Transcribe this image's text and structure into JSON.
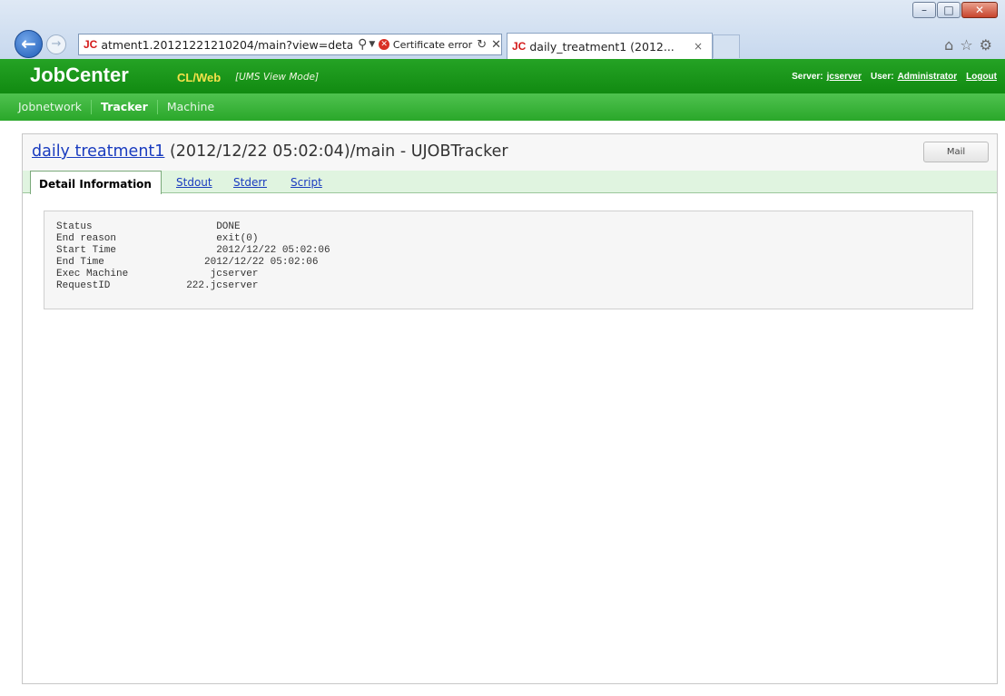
{
  "browser": {
    "window_controls": [
      "–",
      "□",
      "✕"
    ],
    "address": {
      "favicon_text": "JC",
      "url": "atment1.20121221210204/main?view=detail",
      "certificate_text": "Certificate error"
    },
    "tab": {
      "favicon_text": "JC",
      "title": "daily_treatment1 (2012...",
      "close": "×"
    },
    "icons": [
      "home-icon",
      "favorites-star-icon",
      "gear-icon"
    ]
  },
  "app": {
    "brand": "JobCenter",
    "brand_sub": "CL/Web",
    "mode": "[UMS View Mode]",
    "server_label": "Server:",
    "server": "jcserver",
    "user_label": "User:",
    "user": "Administrator",
    "logout": "Logout"
  },
  "nav": [
    {
      "label": "Jobnetwork",
      "active": false
    },
    {
      "label": "Tracker",
      "active": true
    },
    {
      "label": "Machine",
      "active": false
    }
  ],
  "job": {
    "link": "daily treatment1",
    "rest": " (2012/12/22 05:02:04)/main - UJOBTracker",
    "mail_button": "Mail"
  },
  "tabs": [
    {
      "label": "Detail Information",
      "active": true
    },
    {
      "label": "Stdout",
      "active": false
    },
    {
      "label": "Stderr",
      "active": false
    },
    {
      "label": "Script",
      "active": false
    }
  ],
  "detail": [
    {
      "key": "Status",
      "value": "       DONE"
    },
    {
      "key": "End reason",
      "value": "       exit(0)"
    },
    {
      "key": "Start Time",
      "value": "       2012/12/22 05:02:06"
    },
    {
      "key": "End Time",
      "value": "     2012/12/22 05:02:06"
    },
    {
      "key": "Exec Machine",
      "value": "      jcserver"
    },
    {
      "key": "RequestID",
      "value": "  222.jcserver"
    }
  ],
  "colors": {
    "header_green": "#118a11",
    "nav_green": "#2aa72a",
    "brand_sub_yellow": "#f6e24a",
    "link_blue": "#1a3cbf",
    "tab_strip": "#e0f4e0"
  }
}
